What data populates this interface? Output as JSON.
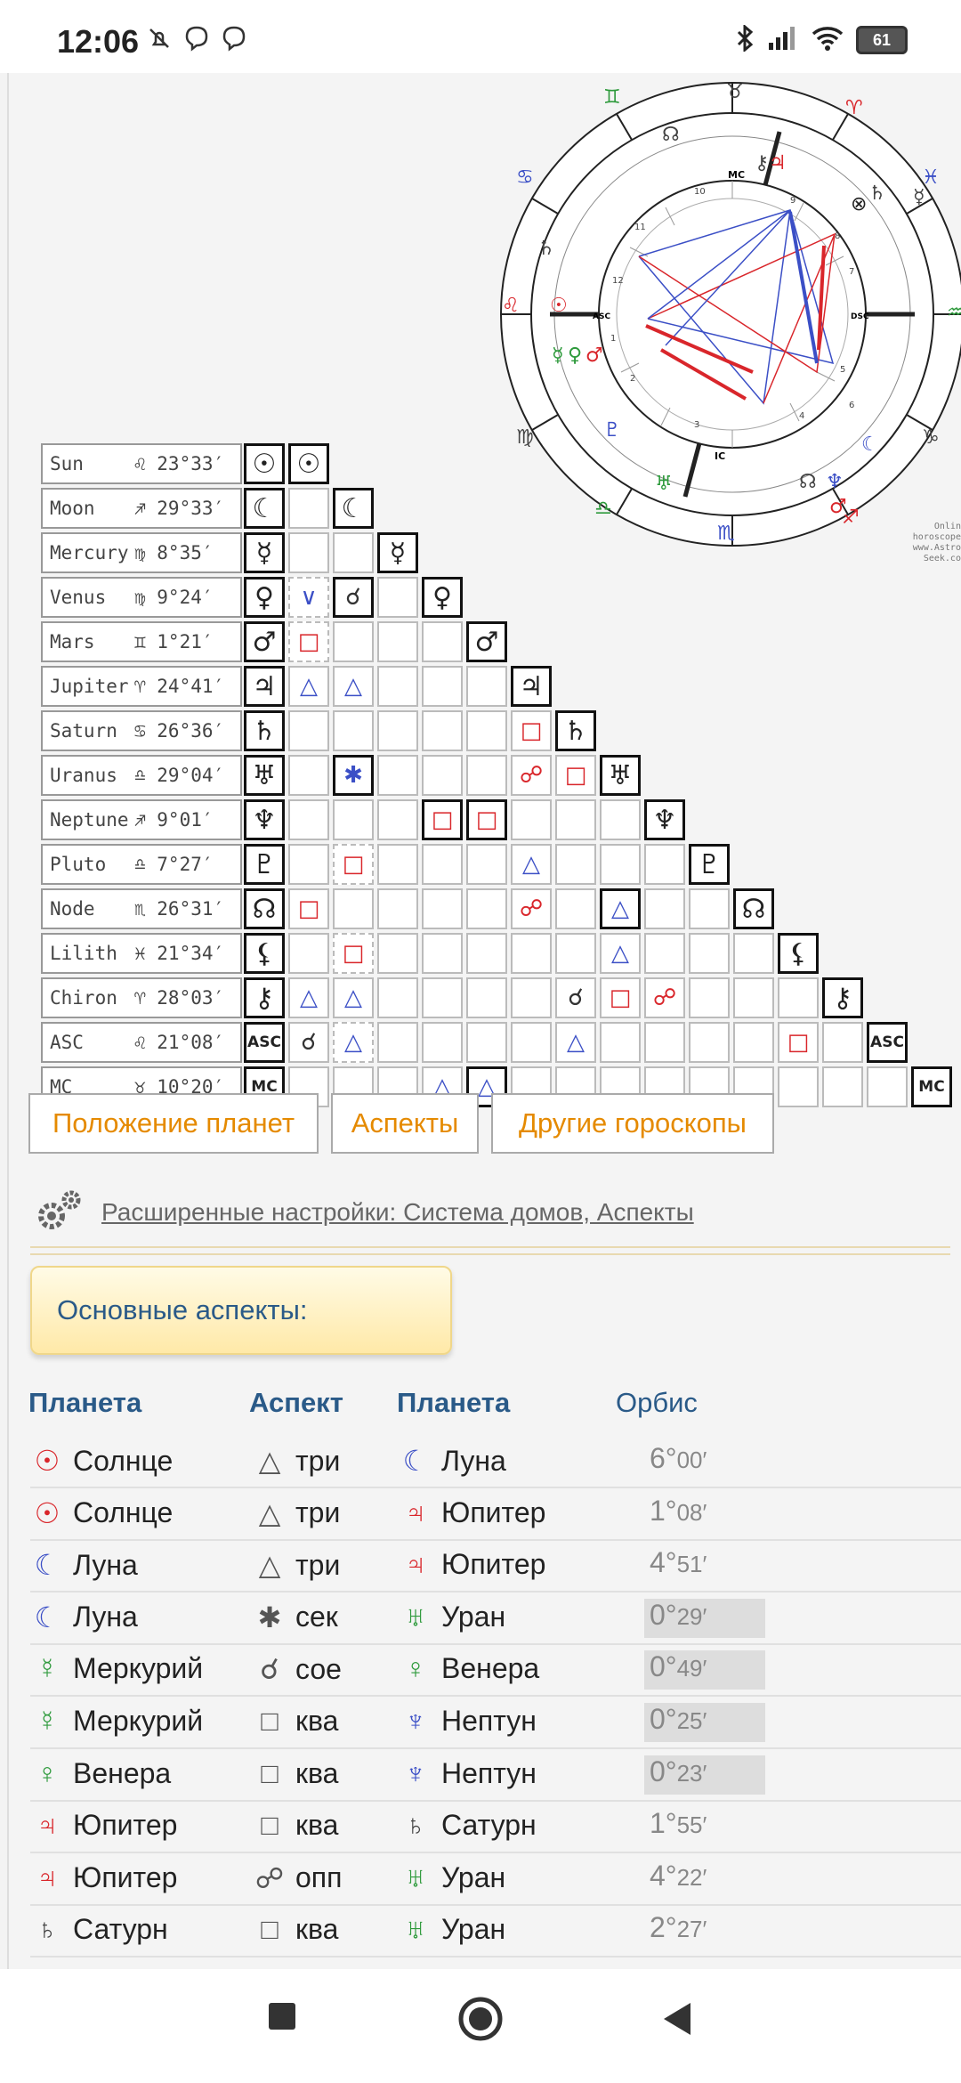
{
  "status": {
    "time": "12:06",
    "battery": "61"
  },
  "wheel": {
    "credit1": "Online horoscopes",
    "credit2": "www.Astro-Seek.com"
  },
  "planets": [
    {
      "name": "Sun",
      "sign": "♌",
      "deg": "23°33′",
      "glyph": "☉",
      "color": "#111"
    },
    {
      "name": "Moon",
      "sign": "♐",
      "deg": "29°33′",
      "glyph": "☾",
      "color": "#111"
    },
    {
      "name": "Mercury",
      "sign": "♍",
      "deg": "8°35′",
      "glyph": "☿",
      "color": "#111"
    },
    {
      "name": "Venus",
      "sign": "♍",
      "deg": "9°24′",
      "glyph": "♀",
      "color": "#111"
    },
    {
      "name": "Mars",
      "sign": "♊",
      "deg": "1°21′",
      "glyph": "♂",
      "color": "#111"
    },
    {
      "name": "Jupiter",
      "sign": "♈",
      "deg": "24°41′",
      "glyph": "♃",
      "color": "#111"
    },
    {
      "name": "Saturn",
      "sign": "♋",
      "deg": "26°36′",
      "glyph": "♄",
      "color": "#111"
    },
    {
      "name": "Uranus",
      "sign": "♎",
      "deg": "29°04′",
      "glyph": "♅",
      "color": "#111"
    },
    {
      "name": "Neptune",
      "sign": "♐",
      "deg": "9°01′",
      "glyph": "♆",
      "color": "#111"
    },
    {
      "name": "Pluto",
      "sign": "♎",
      "deg": "7°27′",
      "glyph": "♇",
      "color": "#111"
    },
    {
      "name": "Node",
      "sign": "♏",
      "deg": "26°31′",
      "glyph": "☊",
      "color": "#111"
    },
    {
      "name": "Lilith",
      "sign": "♓",
      "deg": "21°34′",
      "glyph": "⚸",
      "color": "#111"
    },
    {
      "name": "Chiron",
      "sign": "♈",
      "deg": "28°03′",
      "glyph": "⚷",
      "color": "#111"
    },
    {
      "name": "ASC",
      "sign": "♌",
      "deg": "21°08′",
      "glyph": "ASC",
      "color": "#111"
    },
    {
      "name": "MC",
      "sign": "♉",
      "deg": "10°20′",
      "glyph": "MC",
      "color": "#111"
    }
  ],
  "grid_aspects": [
    [
      1,
      0,
      "tri",
      "blue",
      ""
    ],
    [
      3,
      1,
      "sem",
      "blue",
      "dashed"
    ],
    [
      3,
      2,
      "con",
      "dark",
      "strong"
    ],
    [
      4,
      1,
      "sq",
      "red",
      "dashed"
    ],
    [
      5,
      1,
      "tri",
      "blue",
      ""
    ],
    [
      5,
      2,
      "tri",
      "blue",
      ""
    ],
    [
      6,
      6,
      "sq",
      "red",
      ""
    ],
    [
      7,
      2,
      "sex",
      "blue",
      "strong"
    ],
    [
      7,
      6,
      "opp",
      "red",
      ""
    ],
    [
      7,
      7,
      "sq",
      "red",
      ""
    ],
    [
      8,
      4,
      "sq",
      "red",
      "strong"
    ],
    [
      8,
      5,
      "sq",
      "red",
      "strong"
    ],
    [
      9,
      2,
      "sq",
      "red",
      "dashed"
    ],
    [
      9,
      6,
      "tri",
      "blue",
      ""
    ],
    [
      9,
      10,
      "sex",
      "blue",
      ""
    ],
    [
      10,
      1,
      "sq",
      "red",
      ""
    ],
    [
      10,
      6,
      "opp",
      "red",
      ""
    ],
    [
      10,
      8,
      "tri",
      "blue",
      "strong"
    ],
    [
      11,
      2,
      "sq",
      "red",
      "dashed"
    ],
    [
      11,
      8,
      "tri",
      "blue",
      ""
    ],
    [
      11,
      12,
      "tri",
      "blue",
      ""
    ],
    [
      12,
      1,
      "tri",
      "blue",
      ""
    ],
    [
      12,
      2,
      "tri",
      "blue",
      ""
    ],
    [
      12,
      7,
      "con",
      "dark",
      ""
    ],
    [
      12,
      8,
      "sq",
      "red",
      ""
    ],
    [
      12,
      9,
      "opp",
      "red",
      ""
    ],
    [
      13,
      1,
      "con",
      "dark",
      ""
    ],
    [
      13,
      2,
      "tri",
      "blue",
      "dashed"
    ],
    [
      13,
      7,
      "tri",
      "blue",
      ""
    ],
    [
      13,
      12,
      "sq",
      "red",
      ""
    ],
    [
      14,
      4,
      "tri",
      "blue",
      ""
    ],
    [
      14,
      5,
      "tri",
      "blue",
      "strong"
    ]
  ],
  "buttons": {
    "positions": "Положение планет",
    "aspects": "Аспекты",
    "other": "Другие гороскопы"
  },
  "settings_link": "Расширенные настройки: Система домов, Аспекты",
  "tab_label": "Основные аспекты:",
  "table": {
    "headers": {
      "planet1": "Планета",
      "aspect": "Аспект",
      "planet2": "Планета",
      "orb": "Орбис"
    },
    "rows": [
      {
        "p1g": "☉",
        "p1c": "#d9262b",
        "p1": "Солнце",
        "ag": "△",
        "a": "три",
        "p2g": "☾",
        "p2c": "#3b4fc6",
        "p2": "Луна",
        "od": "6°",
        "om": "00′",
        "tight": false
      },
      {
        "p1g": "☉",
        "p1c": "#d9262b",
        "p1": "Солнце",
        "ag": "△",
        "a": "три",
        "p2g": "♃",
        "p2c": "#d9262b",
        "p2": "Юпитер",
        "od": "1°",
        "om": "08′",
        "tight": false
      },
      {
        "p1g": "☾",
        "p1c": "#3b4fc6",
        "p1": "Луна",
        "ag": "△",
        "a": "три",
        "p2g": "♃",
        "p2c": "#d9262b",
        "p2": "Юпитер",
        "od": "4°",
        "om": "51′",
        "tight": false
      },
      {
        "p1g": "☾",
        "p1c": "#3b4fc6",
        "p1": "Луна",
        "ag": "✱",
        "a": "сек",
        "p2g": "♅",
        "p2c": "#2e9a3c",
        "p2": "Уран",
        "od": "0°",
        "om": "29′",
        "tight": true
      },
      {
        "p1g": "☿",
        "p1c": "#2e9a3c",
        "p1": "Меркурий",
        "ag": "☌",
        "a": "сое",
        "p2g": "♀",
        "p2c": "#2e9a3c",
        "p2": "Венера",
        "od": "0°",
        "om": "49′",
        "tight": true
      },
      {
        "p1g": "☿",
        "p1c": "#2e9a3c",
        "p1": "Меркурий",
        "ag": "□",
        "a": "ква",
        "p2g": "♆",
        "p2c": "#3b4fc6",
        "p2": "Нептун",
        "od": "0°",
        "om": "25′",
        "tight": true
      },
      {
        "p1g": "♀",
        "p1c": "#2e9a3c",
        "p1": "Венера",
        "ag": "□",
        "a": "ква",
        "p2g": "♆",
        "p2c": "#3b4fc6",
        "p2": "Нептун",
        "od": "0°",
        "om": "23′",
        "tight": true
      },
      {
        "p1g": "♃",
        "p1c": "#d9262b",
        "p1": "Юпитер",
        "ag": "□",
        "a": "ква",
        "p2g": "♄",
        "p2c": "#444",
        "p2": "Сатурн",
        "od": "1°",
        "om": "55′",
        "tight": false
      },
      {
        "p1g": "♃",
        "p1c": "#d9262b",
        "p1": "Юпитер",
        "ag": "☍",
        "a": "опп",
        "p2g": "♅",
        "p2c": "#2e9a3c",
        "p2": "Уран",
        "od": "4°",
        "om": "22′",
        "tight": false
      },
      {
        "p1g": "♄",
        "p1c": "#444",
        "p1": "Сатурн",
        "ag": "□",
        "a": "ква",
        "p2g": "♅",
        "p2c": "#2e9a3c",
        "p2": "Уран",
        "od": "2°",
        "om": "27′",
        "tight": false
      }
    ]
  },
  "colors": {
    "accent": "#e58a00",
    "heading": "#2a5a88",
    "red": "#d9262b",
    "blue": "#3b4fc6"
  }
}
